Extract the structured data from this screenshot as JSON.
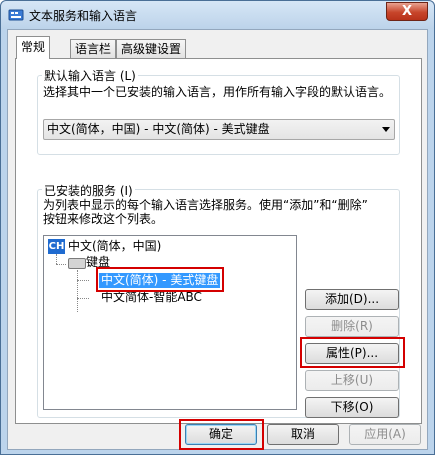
{
  "window": {
    "title": "文本服务和输入语言",
    "close_label": "X"
  },
  "tabs": [
    {
      "label": "常规",
      "active": true
    },
    {
      "label": "语言栏",
      "active": false
    },
    {
      "label": "高级键设置",
      "active": false
    }
  ],
  "default_input": {
    "group_title": "默认输入语言 (L)",
    "description": "选择其中一个已安装的输入语言，用作所有输入字段的默认语言。",
    "selected_value": "中文(简体，中国) - 中文(简体) - 美式键盘"
  },
  "installed": {
    "group_title": "已安装的服务 (I)",
    "description_line1": "为列表中显示的每个输入语言选择服务。使用“添加”和“删除”",
    "description_line2": "按钮来修改这个列表。",
    "tree": {
      "language_badge": "CH",
      "language": "中文(简体，中国)",
      "category": "键盘",
      "items": [
        "中文(简体) - 美式键盘",
        "中文简体-智能ABC"
      ],
      "selected_index": 0
    },
    "buttons": {
      "add": "添加(D)...",
      "remove": "删除(R)",
      "properties": "属性(P)...",
      "move_up": "上移(U)",
      "move_down": "下移(O)"
    }
  },
  "footer": {
    "ok": "确定",
    "cancel": "取消",
    "apply": "应用(A)"
  },
  "colors": {
    "highlight_box": "#d40000",
    "selection": "#3399ff",
    "badge": "#1f6bd0"
  }
}
